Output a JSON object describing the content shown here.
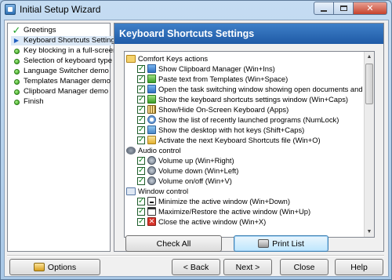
{
  "window": {
    "title": "Initial Setup Wizard"
  },
  "nav": {
    "items": [
      {
        "label": "Greetings",
        "icon": "checkmark-icon",
        "selected": false
      },
      {
        "label": "Keyboard Shortcuts Settings",
        "icon": "arrow-right-icon",
        "selected": true
      },
      {
        "label": "Key blocking in a full-screen",
        "icon": "green-dot-icon",
        "selected": false
      },
      {
        "label": "Selection of keyboard type",
        "icon": "green-dot-icon",
        "selected": false
      },
      {
        "label": "Language Switcher demo",
        "icon": "green-dot-icon",
        "selected": false
      },
      {
        "label": "Templates Manager demo",
        "icon": "green-dot-icon",
        "selected": false
      },
      {
        "label": "Clipboard Manager demo",
        "icon": "green-dot-icon",
        "selected": false
      },
      {
        "label": "Finish",
        "icon": "green-dot-icon",
        "selected": false
      }
    ]
  },
  "panel": {
    "header": "Keyboard Shortcuts Settings",
    "tree": {
      "group1": {
        "label": "Comfort Keys actions",
        "icon": "envelope-icon"
      },
      "g1_items": [
        {
          "label": "Show Clipboard Manager (Win+Ins)",
          "icon": "clipboard-icon",
          "checked": true
        },
        {
          "label": "Paste text from Templates (Win+Space)",
          "icon": "paste-icon",
          "checked": true
        },
        {
          "label": "Open the task switching window showing open documents and running",
          "icon": "task-switch-icon",
          "checked": true
        },
        {
          "label": "Show the keyboard shortcuts settings window (Win+Caps)",
          "icon": "settings-icon",
          "checked": true
        },
        {
          "label": "Show/Hide On-Screen Keyboard (Apps)",
          "icon": "keyboard-icon",
          "checked": true
        },
        {
          "label": "Show the list of recently launched programs (NumLock)",
          "icon": "clock-icon",
          "checked": true
        },
        {
          "label": "Show the desktop with hot keys (Shift+Caps)",
          "icon": "desktop-icon",
          "checked": true
        },
        {
          "label": "Activate the next Keyboard Shortcuts file (Win+O)",
          "icon": "folder-icon",
          "checked": true
        }
      ],
      "group2": {
        "label": "Audio control",
        "icon": "audio-icon"
      },
      "g2_items": [
        {
          "label": "Volume up (Win+Right)",
          "icon": "speaker-icon",
          "checked": true
        },
        {
          "label": "Volume down (Win+Left)",
          "icon": "speaker-icon",
          "checked": true
        },
        {
          "label": "Volume on/off (Win+V)",
          "icon": "speaker-mute-icon",
          "checked": true
        }
      ],
      "group3": {
        "label": "Window control",
        "icon": "window-icon"
      },
      "g3_items": [
        {
          "label": "Minimize the active window (Win+Down)",
          "icon": "minimize-icon",
          "checked": true
        },
        {
          "label": "Maximize/Restore the active window (Win+Up)",
          "icon": "maximize-icon",
          "checked": true
        },
        {
          "label": "Close the active window (Win+X)",
          "icon": "close-window-icon",
          "checked": true
        }
      ]
    },
    "check_all": "Check All",
    "print_list": "Print List"
  },
  "footer": {
    "options": "Options",
    "back": "< Back",
    "next": "Next >",
    "close": "Close",
    "help": "Help"
  }
}
